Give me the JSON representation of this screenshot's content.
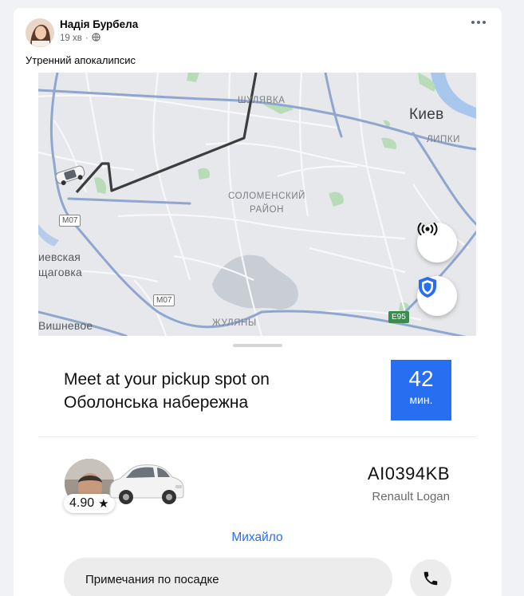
{
  "post": {
    "author": "Надія Бурбела",
    "time": "19 хв",
    "dot": "·",
    "text": "Утренний апокалипсис"
  },
  "map": {
    "labels": {
      "shulyavka": "ШУЛЯВКА",
      "kiev": "Киев",
      "lipki": "ЛИПКИ",
      "solomensky": "СОЛОМЕНСКИЙ\nРАЙОН",
      "kievskaya": "иевская",
      "shchagovka": "щаговка",
      "zhulyany": "ЖУЛЯНЫ",
      "vyshnevoe": "Вишневое"
    },
    "shields": {
      "m07_left": "M07",
      "m07_mid": "M07",
      "e95": "E95"
    }
  },
  "trip": {
    "pickup_title": "Meet at your pickup spot on Оболонська набережна",
    "eta_value": "42",
    "eta_unit": "мин.",
    "rating": "4.90",
    "rating_star": "★",
    "plate": "AI0394KB",
    "car_model": "Renault Logan",
    "driver_name": "Михайло",
    "notes_button": "Примечания по посадке"
  },
  "colors": {
    "accent_blue": "#276ef1",
    "route": "#3d3d3d"
  },
  "icons": [
    "globe-icon",
    "more-icon",
    "broadcast-icon",
    "shield-icon",
    "star-icon",
    "phone-icon"
  ]
}
